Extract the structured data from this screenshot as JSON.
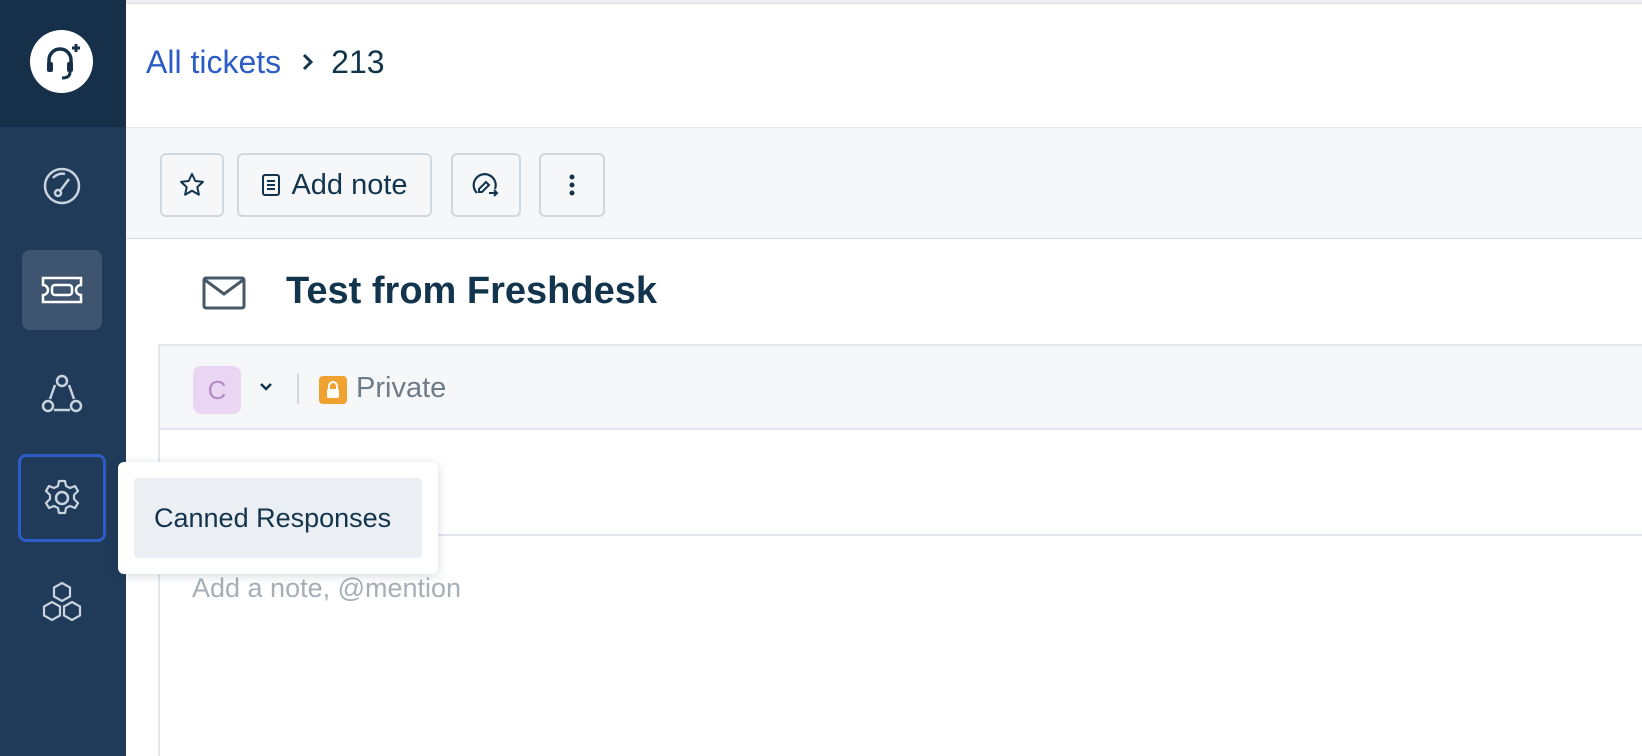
{
  "breadcrumb": {
    "parent": "All tickets",
    "current": "213"
  },
  "toolbar": {
    "add_note_label": "Add note"
  },
  "ticket": {
    "subject": "Test from Freshdesk"
  },
  "editor": {
    "avatar_letter": "C",
    "visibility_label": "Private",
    "note_placeholder": "Add a note, @mention"
  },
  "popover": {
    "item_label": "Canned Responses"
  },
  "sidebar": {
    "items": [
      {
        "icon": "dashboard-icon"
      },
      {
        "icon": "tickets-icon",
        "active": true
      },
      {
        "icon": "contacts-icon"
      },
      {
        "icon": "admin-gear-icon",
        "focused": true
      },
      {
        "icon": "apps-icon"
      }
    ]
  },
  "colors": {
    "sidebar": "#1f3b59",
    "link": "#2c5cc5",
    "lock_badge": "#f0a230",
    "avatar_bg": "#ead6f2"
  }
}
